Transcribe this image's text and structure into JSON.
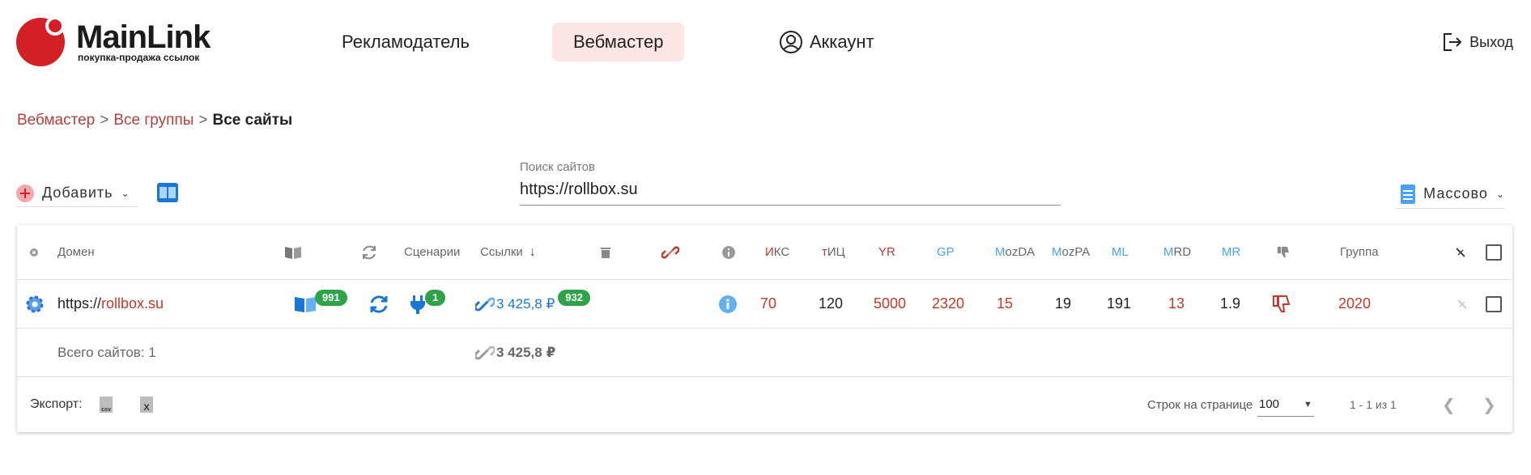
{
  "header": {
    "logo_title": "MainLink",
    "logo_sub": "покупка-продажа ссылок",
    "nav": {
      "advertiser": "Рекламодатель",
      "webmaster": "Вебмастер",
      "account": "Аккаунт"
    },
    "logout": "Выход"
  },
  "breadcrumb": {
    "items": [
      "Вебмастер",
      "Все группы"
    ],
    "separator": ">",
    "current": "Все сайты"
  },
  "toolbar": {
    "add_label": "Добавить",
    "search_label": "Поиск сайтов",
    "search_value": "https://rollbox.su",
    "mass_label": "Массово"
  },
  "table": {
    "headers": {
      "domain": "Домен",
      "scenarios": "Сценарии",
      "links": "Ссылки",
      "iks_prefix": "И",
      "iks_rest": "КС",
      "tic_prefix": "т",
      "tic_rest": "ИЦ",
      "yr": "YR",
      "gp": "GP",
      "mozda_prefix": "M",
      "mozda_rest": "ozDA",
      "mozpa_prefix": "M",
      "mozpa_rest": "ozPA",
      "ml": "ML",
      "mrd_prefix": "M",
      "mrd_rest": "RD",
      "mr": "MR",
      "group": "Группа"
    },
    "row": {
      "domain_prefix": "https://",
      "domain_name": "rollbox.su",
      "pages_badge": "991",
      "scenarios_badge": "1",
      "links_amount": "3 425,8 ₽",
      "links_badge": "932",
      "iks": "70",
      "tic": "120",
      "yr": "5000",
      "gp": "2320",
      "mozda": "15",
      "mozpa": "19",
      "ml": "191",
      "mrd": "13",
      "mr": "1.9",
      "group": "2020"
    },
    "total": {
      "label": "Всего сайтов: 1",
      "amount": "3 425,8 ₽"
    }
  },
  "footer": {
    "export_label": "Экспорт:",
    "csv_label": "csv",
    "xls_label": "X",
    "rows_label": "Строк на странице",
    "rows_value": "100",
    "range": "1 - 1 из 1"
  },
  "colors": {
    "brand_red": "#d32027",
    "accent_blue": "#1976d2",
    "badge_green": "#2ea34a",
    "nav_active_bg": "#fde6e4"
  }
}
